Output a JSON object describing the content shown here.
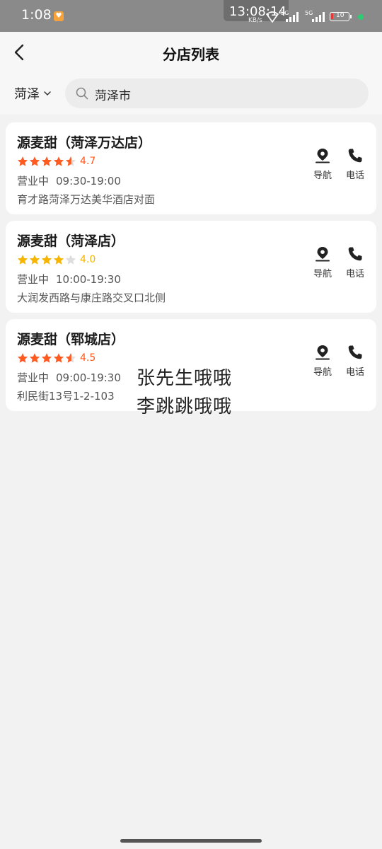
{
  "status_bar": {
    "time": "1:08",
    "clock": "13:08:14",
    "speed_unit": "KB/s",
    "network_1": "5G",
    "network_2": "5G",
    "battery": "10"
  },
  "header": {
    "title": "分店列表",
    "city": "菏泽"
  },
  "search": {
    "value": "菏泽市",
    "placeholder": ""
  },
  "actions": {
    "navigate": "导航",
    "call": "电话"
  },
  "colors": {
    "accent_orange": "#ff5a1f",
    "star_yellow": "#f7b500",
    "star_empty": "#dddddd"
  },
  "stores": [
    {
      "name": "源麦甜（菏泽万达店）",
      "rating": 4.7,
      "rating_text": "4.7",
      "status": "营业中",
      "hours": "09:30-19:00",
      "address": "育才路菏泽万达美华酒店对面"
    },
    {
      "name": "源麦甜（菏泽店）",
      "rating": 4.0,
      "rating_text": "4.0",
      "status": "营业中",
      "hours": "10:00-19:30",
      "address": "大润发西路与康庄路交叉口北侧"
    },
    {
      "name": "源麦甜（郓城店）",
      "rating": 4.5,
      "rating_text": "4.5",
      "status": "营业中",
      "hours": "09:00-19:30",
      "address": "利民街13号1-2-103"
    }
  ],
  "overlay": {
    "line1": "张先生哦哦",
    "line2": "李跳跳哦哦"
  }
}
